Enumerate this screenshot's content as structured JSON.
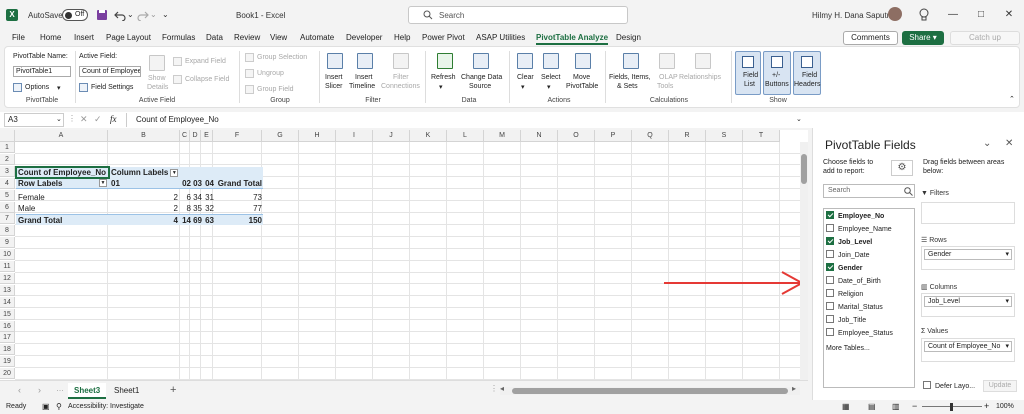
{
  "title_bar": {
    "app_icon": "X",
    "autosave_label": "AutoSave",
    "toggle_state": "Off",
    "save_icon": "save-icon",
    "undo_icon": "undo-icon",
    "redo_icon": "redo-icon",
    "doc_title": "Book1 - Excel",
    "search_placeholder": "Search",
    "user_name": "Hilmy H. Dana Saputra"
  },
  "menu": {
    "items": [
      "File",
      "Home",
      "Insert",
      "Page Layout",
      "Formulas",
      "Data",
      "Review",
      "View",
      "Automate",
      "Developer",
      "Help",
      "Power Pivot",
      "ASAP Utilities",
      "PivotTable Analyze",
      "Design"
    ],
    "active": "PivotTable Analyze",
    "comments": "Comments",
    "share": "Share",
    "catch_up": "Catch up"
  },
  "ribbon": {
    "pivottable": {
      "name_label": "PivotTable Name:",
      "name_value": "PivotTable1",
      "options": "Options",
      "group": "PivotTable"
    },
    "active_field": {
      "label": "Active Field:",
      "value": "Count of Employee_No",
      "field_settings": "Field Settings",
      "show": "Show",
      "details": "Details",
      "expand": "Expand Field",
      "collapse": "Collapse Field",
      "group": "Active Field"
    },
    "group_grp": {
      "selection": "Group Selection",
      "ungroup": "Ungroup",
      "field": "Group Field",
      "group": "Group"
    },
    "filter": {
      "slicer1": "Insert",
      "slicer2": "Slicer",
      "timeline1": "Insert",
      "timeline2": "Timeline",
      "conn1": "Filter",
      "conn2": "Connections",
      "group": "Filter"
    },
    "data": {
      "refresh": "Refresh",
      "change1": "Change Data",
      "change2": "Source",
      "group": "Data"
    },
    "actions": {
      "clear": "Clear",
      "select": "Select",
      "move1": "Move",
      "move2": "PivotTable",
      "group": "Actions"
    },
    "calculations": {
      "fields1": "Fields, Items,",
      "fields2": "& Sets",
      "olap1": "OLAP",
      "olap2": "Tools",
      "relationships": "Relationships",
      "group": "Calculations"
    },
    "show": {
      "field_list1": "Field",
      "field_list2": "List",
      "buttons1": "+/-",
      "buttons2": "Buttons",
      "headers1": "Field",
      "headers2": "Headers",
      "group": "Show"
    }
  },
  "formula": {
    "cell": "A3",
    "fx": "fx",
    "content": "Count of Employee_No"
  },
  "grid": {
    "columns": [
      "A",
      "B",
      "C",
      "D",
      "E",
      "F",
      "G",
      "H",
      "I",
      "J",
      "K",
      "L",
      "M",
      "N",
      "O",
      "P",
      "Q",
      "R",
      "S",
      "T"
    ],
    "rows": [
      "1",
      "2",
      "3",
      "4",
      "5",
      "6",
      "7",
      "8",
      "9",
      "10",
      "11",
      "12",
      "13",
      "14",
      "15",
      "16",
      "17",
      "18",
      "19",
      "20"
    ]
  },
  "pivot": {
    "values_label": "Count of Employee_No",
    "column_labels": "Column Labels",
    "row_labels": "Row Labels",
    "col_headers": [
      "01",
      "02",
      "03",
      "04",
      "Grand Total"
    ],
    "rows": [
      {
        "label": "Female",
        "values": [
          "2",
          "6",
          "34",
          "31",
          "73"
        ]
      },
      {
        "label": "Male",
        "values": [
          "2",
          "8",
          "35",
          "32",
          "77"
        ]
      }
    ],
    "grand_total": {
      "label": "Grand Total",
      "values": [
        "4",
        "14",
        "69",
        "63",
        "150"
      ]
    }
  },
  "sheets": {
    "tabs": [
      "Sheet3",
      "Sheet1"
    ],
    "active": "Sheet3",
    "add": "+"
  },
  "status": {
    "ready": "Ready",
    "accessibility": "Accessibility: Investigate",
    "zoom": "100%"
  },
  "pane": {
    "title": "PivotTable Fields",
    "choose": "Choose fields to add to report:",
    "drag": "Drag fields between areas below:",
    "search_placeholder": "Search",
    "fields": [
      {
        "name": "Employee_No",
        "checked": true
      },
      {
        "name": "Employee_Name",
        "checked": false
      },
      {
        "name": "Job_Level",
        "checked": true
      },
      {
        "name": "Join_Date",
        "checked": false
      },
      {
        "name": "Gender",
        "checked": true
      },
      {
        "name": "Date_of_Birth",
        "checked": false
      },
      {
        "name": "Religion",
        "checked": false
      },
      {
        "name": "Marital_Status",
        "checked": false
      },
      {
        "name": "Job_Title",
        "checked": false
      },
      {
        "name": "Employee_Status",
        "checked": false
      }
    ],
    "more_tables": "More Tables...",
    "areas": {
      "filters": {
        "title": "Filters",
        "value": ""
      },
      "rows": {
        "title": "Rows",
        "value": "Gender"
      },
      "columns": {
        "title": "Columns",
        "value": "Job_Level"
      },
      "values": {
        "title": "Values",
        "value": "Count of Employee_No"
      }
    },
    "defer": "Defer Layo...",
    "update": "Update"
  },
  "colors": {
    "excel_green": "#1d6f42",
    "pivot_header": "#ddebf7",
    "arrow": "#e53935"
  }
}
